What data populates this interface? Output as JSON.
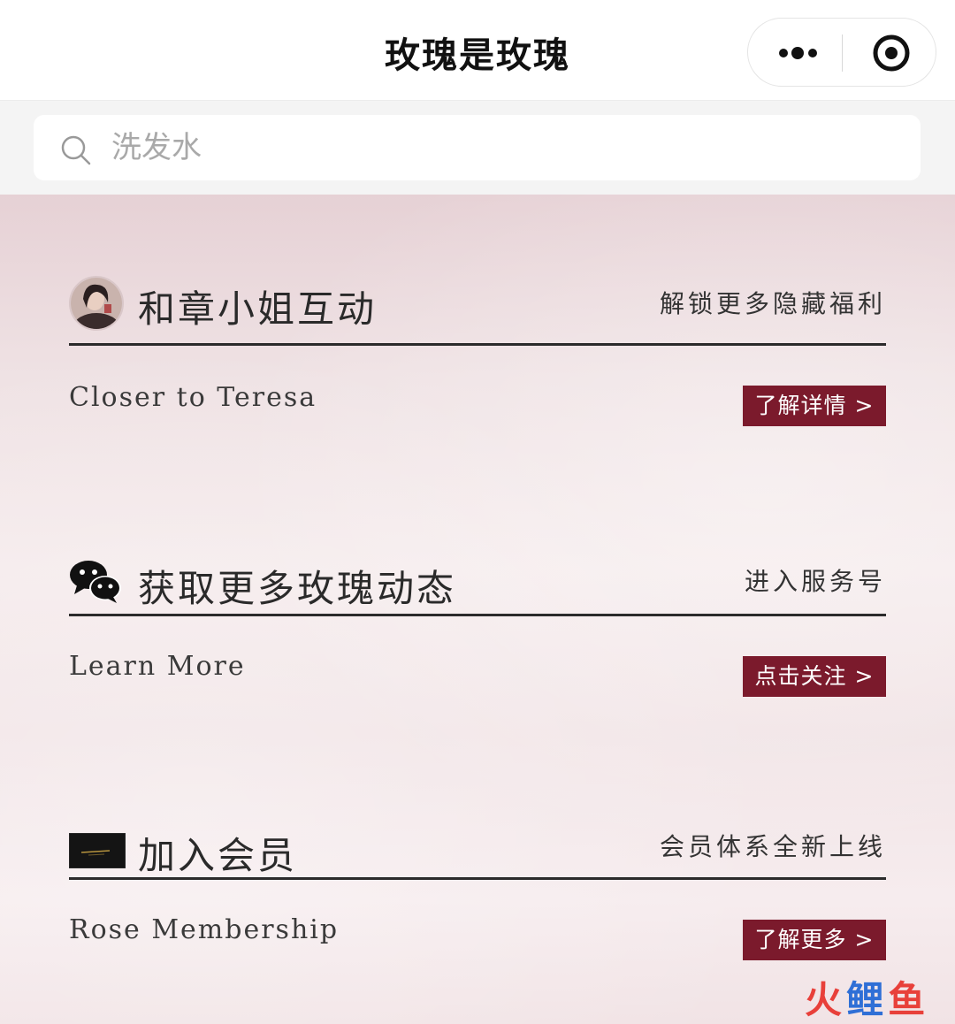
{
  "app": {
    "title": "玫瑰是玫瑰"
  },
  "capsule": {
    "more_icon": "more-dots-icon",
    "close_icon": "target-close-icon"
  },
  "search": {
    "placeholder": "洗发水",
    "icon": "search-icon"
  },
  "sections": [
    {
      "icon": "avatar",
      "title": "和章小姐互动",
      "hint": "解锁更多隐藏福利",
      "subtitle": "Closer to Teresa",
      "cta": "了解详情 >"
    },
    {
      "icon": "wechat-icon",
      "title": "获取更多玫瑰动态",
      "hint": "进入服务号",
      "subtitle": "Learn More",
      "cta": "点击关注 >"
    },
    {
      "icon": "membership-card-icon",
      "title": "加入会员",
      "hint": "会员体系全新上线",
      "subtitle": "Rose Membership",
      "cta": "了解更多 >"
    }
  ],
  "colors": {
    "cta_background": "#7b1a2c",
    "rule": "#2b2b2b",
    "watermark_red": "#e8403a",
    "watermark_blue": "#2f6fd6"
  },
  "watermark": {
    "chars": [
      "火",
      "鲤",
      "鱼"
    ]
  }
}
